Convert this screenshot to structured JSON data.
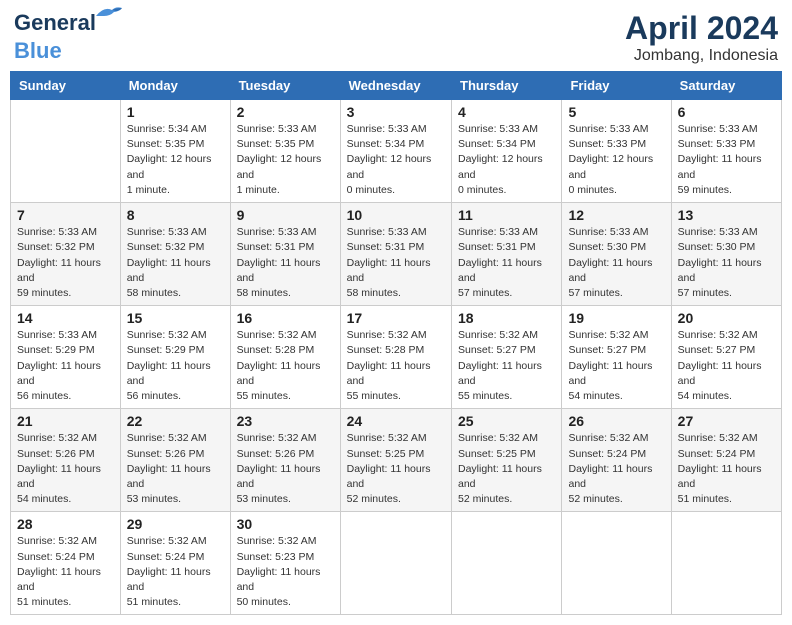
{
  "header": {
    "logo_line1": "General",
    "logo_line2": "Blue",
    "month": "April 2024",
    "location": "Jombang, Indonesia"
  },
  "weekdays": [
    "Sunday",
    "Monday",
    "Tuesday",
    "Wednesday",
    "Thursday",
    "Friday",
    "Saturday"
  ],
  "weeks": [
    [
      {
        "day": "",
        "sunrise": "",
        "sunset": "",
        "daylight": ""
      },
      {
        "day": "1",
        "sunrise": "Sunrise: 5:34 AM",
        "sunset": "Sunset: 5:35 PM",
        "daylight": "Daylight: 12 hours and 1 minute."
      },
      {
        "day": "2",
        "sunrise": "Sunrise: 5:33 AM",
        "sunset": "Sunset: 5:35 PM",
        "daylight": "Daylight: 12 hours and 1 minute."
      },
      {
        "day": "3",
        "sunrise": "Sunrise: 5:33 AM",
        "sunset": "Sunset: 5:34 PM",
        "daylight": "Daylight: 12 hours and 0 minutes."
      },
      {
        "day": "4",
        "sunrise": "Sunrise: 5:33 AM",
        "sunset": "Sunset: 5:34 PM",
        "daylight": "Daylight: 12 hours and 0 minutes."
      },
      {
        "day": "5",
        "sunrise": "Sunrise: 5:33 AM",
        "sunset": "Sunset: 5:33 PM",
        "daylight": "Daylight: 12 hours and 0 minutes."
      },
      {
        "day": "6",
        "sunrise": "Sunrise: 5:33 AM",
        "sunset": "Sunset: 5:33 PM",
        "daylight": "Daylight: 11 hours and 59 minutes."
      }
    ],
    [
      {
        "day": "7",
        "sunrise": "Sunrise: 5:33 AM",
        "sunset": "Sunset: 5:32 PM",
        "daylight": "Daylight: 11 hours and 59 minutes."
      },
      {
        "day": "8",
        "sunrise": "Sunrise: 5:33 AM",
        "sunset": "Sunset: 5:32 PM",
        "daylight": "Daylight: 11 hours and 58 minutes."
      },
      {
        "day": "9",
        "sunrise": "Sunrise: 5:33 AM",
        "sunset": "Sunset: 5:31 PM",
        "daylight": "Daylight: 11 hours and 58 minutes."
      },
      {
        "day": "10",
        "sunrise": "Sunrise: 5:33 AM",
        "sunset": "Sunset: 5:31 PM",
        "daylight": "Daylight: 11 hours and 58 minutes."
      },
      {
        "day": "11",
        "sunrise": "Sunrise: 5:33 AM",
        "sunset": "Sunset: 5:31 PM",
        "daylight": "Daylight: 11 hours and 57 minutes."
      },
      {
        "day": "12",
        "sunrise": "Sunrise: 5:33 AM",
        "sunset": "Sunset: 5:30 PM",
        "daylight": "Daylight: 11 hours and 57 minutes."
      },
      {
        "day": "13",
        "sunrise": "Sunrise: 5:33 AM",
        "sunset": "Sunset: 5:30 PM",
        "daylight": "Daylight: 11 hours and 57 minutes."
      }
    ],
    [
      {
        "day": "14",
        "sunrise": "Sunrise: 5:33 AM",
        "sunset": "Sunset: 5:29 PM",
        "daylight": "Daylight: 11 hours and 56 minutes."
      },
      {
        "day": "15",
        "sunrise": "Sunrise: 5:32 AM",
        "sunset": "Sunset: 5:29 PM",
        "daylight": "Daylight: 11 hours and 56 minutes."
      },
      {
        "day": "16",
        "sunrise": "Sunrise: 5:32 AM",
        "sunset": "Sunset: 5:28 PM",
        "daylight": "Daylight: 11 hours and 55 minutes."
      },
      {
        "day": "17",
        "sunrise": "Sunrise: 5:32 AM",
        "sunset": "Sunset: 5:28 PM",
        "daylight": "Daylight: 11 hours and 55 minutes."
      },
      {
        "day": "18",
        "sunrise": "Sunrise: 5:32 AM",
        "sunset": "Sunset: 5:27 PM",
        "daylight": "Daylight: 11 hours and 55 minutes."
      },
      {
        "day": "19",
        "sunrise": "Sunrise: 5:32 AM",
        "sunset": "Sunset: 5:27 PM",
        "daylight": "Daylight: 11 hours and 54 minutes."
      },
      {
        "day": "20",
        "sunrise": "Sunrise: 5:32 AM",
        "sunset": "Sunset: 5:27 PM",
        "daylight": "Daylight: 11 hours and 54 minutes."
      }
    ],
    [
      {
        "day": "21",
        "sunrise": "Sunrise: 5:32 AM",
        "sunset": "Sunset: 5:26 PM",
        "daylight": "Daylight: 11 hours and 54 minutes."
      },
      {
        "day": "22",
        "sunrise": "Sunrise: 5:32 AM",
        "sunset": "Sunset: 5:26 PM",
        "daylight": "Daylight: 11 hours and 53 minutes."
      },
      {
        "day": "23",
        "sunrise": "Sunrise: 5:32 AM",
        "sunset": "Sunset: 5:26 PM",
        "daylight": "Daylight: 11 hours and 53 minutes."
      },
      {
        "day": "24",
        "sunrise": "Sunrise: 5:32 AM",
        "sunset": "Sunset: 5:25 PM",
        "daylight": "Daylight: 11 hours and 52 minutes."
      },
      {
        "day": "25",
        "sunrise": "Sunrise: 5:32 AM",
        "sunset": "Sunset: 5:25 PM",
        "daylight": "Daylight: 11 hours and 52 minutes."
      },
      {
        "day": "26",
        "sunrise": "Sunrise: 5:32 AM",
        "sunset": "Sunset: 5:24 PM",
        "daylight": "Daylight: 11 hours and 52 minutes."
      },
      {
        "day": "27",
        "sunrise": "Sunrise: 5:32 AM",
        "sunset": "Sunset: 5:24 PM",
        "daylight": "Daylight: 11 hours and 51 minutes."
      }
    ],
    [
      {
        "day": "28",
        "sunrise": "Sunrise: 5:32 AM",
        "sunset": "Sunset: 5:24 PM",
        "daylight": "Daylight: 11 hours and 51 minutes."
      },
      {
        "day": "29",
        "sunrise": "Sunrise: 5:32 AM",
        "sunset": "Sunset: 5:24 PM",
        "daylight": "Daylight: 11 hours and 51 minutes."
      },
      {
        "day": "30",
        "sunrise": "Sunrise: 5:32 AM",
        "sunset": "Sunset: 5:23 PM",
        "daylight": "Daylight: 11 hours and 50 minutes."
      },
      {
        "day": "",
        "sunrise": "",
        "sunset": "",
        "daylight": ""
      },
      {
        "day": "",
        "sunrise": "",
        "sunset": "",
        "daylight": ""
      },
      {
        "day": "",
        "sunrise": "",
        "sunset": "",
        "daylight": ""
      },
      {
        "day": "",
        "sunrise": "",
        "sunset": "",
        "daylight": ""
      }
    ]
  ]
}
